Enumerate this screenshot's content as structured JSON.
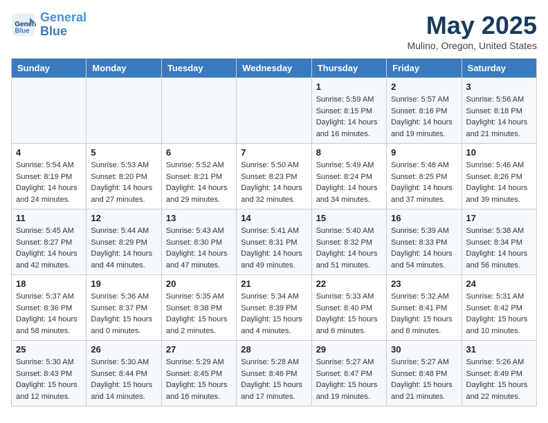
{
  "header": {
    "logo_line1": "General",
    "logo_line2": "Blue",
    "month_title": "May 2025",
    "location": "Mulino, Oregon, United States"
  },
  "days_of_week": [
    "Sunday",
    "Monday",
    "Tuesday",
    "Wednesday",
    "Thursday",
    "Friday",
    "Saturday"
  ],
  "weeks": [
    [
      {
        "day": "",
        "sunrise": "",
        "sunset": "",
        "daylight": ""
      },
      {
        "day": "",
        "sunrise": "",
        "sunset": "",
        "daylight": ""
      },
      {
        "day": "",
        "sunrise": "",
        "sunset": "",
        "daylight": ""
      },
      {
        "day": "",
        "sunrise": "",
        "sunset": "",
        "daylight": ""
      },
      {
        "day": "1",
        "sunrise": "Sunrise: 5:59 AM",
        "sunset": "Sunset: 8:15 PM",
        "daylight": "Daylight: 14 hours and 16 minutes."
      },
      {
        "day": "2",
        "sunrise": "Sunrise: 5:57 AM",
        "sunset": "Sunset: 8:16 PM",
        "daylight": "Daylight: 14 hours and 19 minutes."
      },
      {
        "day": "3",
        "sunrise": "Sunrise: 5:56 AM",
        "sunset": "Sunset: 8:18 PM",
        "daylight": "Daylight: 14 hours and 21 minutes."
      }
    ],
    [
      {
        "day": "4",
        "sunrise": "Sunrise: 5:54 AM",
        "sunset": "Sunset: 8:19 PM",
        "daylight": "Daylight: 14 hours and 24 minutes."
      },
      {
        "day": "5",
        "sunrise": "Sunrise: 5:53 AM",
        "sunset": "Sunset: 8:20 PM",
        "daylight": "Daylight: 14 hours and 27 minutes."
      },
      {
        "day": "6",
        "sunrise": "Sunrise: 5:52 AM",
        "sunset": "Sunset: 8:21 PM",
        "daylight": "Daylight: 14 hours and 29 minutes."
      },
      {
        "day": "7",
        "sunrise": "Sunrise: 5:50 AM",
        "sunset": "Sunset: 8:23 PM",
        "daylight": "Daylight: 14 hours and 32 minutes."
      },
      {
        "day": "8",
        "sunrise": "Sunrise: 5:49 AM",
        "sunset": "Sunset: 8:24 PM",
        "daylight": "Daylight: 14 hours and 34 minutes."
      },
      {
        "day": "9",
        "sunrise": "Sunrise: 5:48 AM",
        "sunset": "Sunset: 8:25 PM",
        "daylight": "Daylight: 14 hours and 37 minutes."
      },
      {
        "day": "10",
        "sunrise": "Sunrise: 5:46 AM",
        "sunset": "Sunset: 8:26 PM",
        "daylight": "Daylight: 14 hours and 39 minutes."
      }
    ],
    [
      {
        "day": "11",
        "sunrise": "Sunrise: 5:45 AM",
        "sunset": "Sunset: 8:27 PM",
        "daylight": "Daylight: 14 hours and 42 minutes."
      },
      {
        "day": "12",
        "sunrise": "Sunrise: 5:44 AM",
        "sunset": "Sunset: 8:29 PM",
        "daylight": "Daylight: 14 hours and 44 minutes."
      },
      {
        "day": "13",
        "sunrise": "Sunrise: 5:43 AM",
        "sunset": "Sunset: 8:30 PM",
        "daylight": "Daylight: 14 hours and 47 minutes."
      },
      {
        "day": "14",
        "sunrise": "Sunrise: 5:41 AM",
        "sunset": "Sunset: 8:31 PM",
        "daylight": "Daylight: 14 hours and 49 minutes."
      },
      {
        "day": "15",
        "sunrise": "Sunrise: 5:40 AM",
        "sunset": "Sunset: 8:32 PM",
        "daylight": "Daylight: 14 hours and 51 minutes."
      },
      {
        "day": "16",
        "sunrise": "Sunrise: 5:39 AM",
        "sunset": "Sunset: 8:33 PM",
        "daylight": "Daylight: 14 hours and 54 minutes."
      },
      {
        "day": "17",
        "sunrise": "Sunrise: 5:38 AM",
        "sunset": "Sunset: 8:34 PM",
        "daylight": "Daylight: 14 hours and 56 minutes."
      }
    ],
    [
      {
        "day": "18",
        "sunrise": "Sunrise: 5:37 AM",
        "sunset": "Sunset: 8:36 PM",
        "daylight": "Daylight: 14 hours and 58 minutes."
      },
      {
        "day": "19",
        "sunrise": "Sunrise: 5:36 AM",
        "sunset": "Sunset: 8:37 PM",
        "daylight": "Daylight: 15 hours and 0 minutes."
      },
      {
        "day": "20",
        "sunrise": "Sunrise: 5:35 AM",
        "sunset": "Sunset: 8:38 PM",
        "daylight": "Daylight: 15 hours and 2 minutes."
      },
      {
        "day": "21",
        "sunrise": "Sunrise: 5:34 AM",
        "sunset": "Sunset: 8:39 PM",
        "daylight": "Daylight: 15 hours and 4 minutes."
      },
      {
        "day": "22",
        "sunrise": "Sunrise: 5:33 AM",
        "sunset": "Sunset: 8:40 PM",
        "daylight": "Daylight: 15 hours and 6 minutes."
      },
      {
        "day": "23",
        "sunrise": "Sunrise: 5:32 AM",
        "sunset": "Sunset: 8:41 PM",
        "daylight": "Daylight: 15 hours and 8 minutes."
      },
      {
        "day": "24",
        "sunrise": "Sunrise: 5:31 AM",
        "sunset": "Sunset: 8:42 PM",
        "daylight": "Daylight: 15 hours and 10 minutes."
      }
    ],
    [
      {
        "day": "25",
        "sunrise": "Sunrise: 5:30 AM",
        "sunset": "Sunset: 8:43 PM",
        "daylight": "Daylight: 15 hours and 12 minutes."
      },
      {
        "day": "26",
        "sunrise": "Sunrise: 5:30 AM",
        "sunset": "Sunset: 8:44 PM",
        "daylight": "Daylight: 15 hours and 14 minutes."
      },
      {
        "day": "27",
        "sunrise": "Sunrise: 5:29 AM",
        "sunset": "Sunset: 8:45 PM",
        "daylight": "Daylight: 15 hours and 16 minutes."
      },
      {
        "day": "28",
        "sunrise": "Sunrise: 5:28 AM",
        "sunset": "Sunset: 8:46 PM",
        "daylight": "Daylight: 15 hours and 17 minutes."
      },
      {
        "day": "29",
        "sunrise": "Sunrise: 5:27 AM",
        "sunset": "Sunset: 8:47 PM",
        "daylight": "Daylight: 15 hours and 19 minutes."
      },
      {
        "day": "30",
        "sunrise": "Sunrise: 5:27 AM",
        "sunset": "Sunset: 8:48 PM",
        "daylight": "Daylight: 15 hours and 21 minutes."
      },
      {
        "day": "31",
        "sunrise": "Sunrise: 5:26 AM",
        "sunset": "Sunset: 8:49 PM",
        "daylight": "Daylight: 15 hours and 22 minutes."
      }
    ]
  ]
}
